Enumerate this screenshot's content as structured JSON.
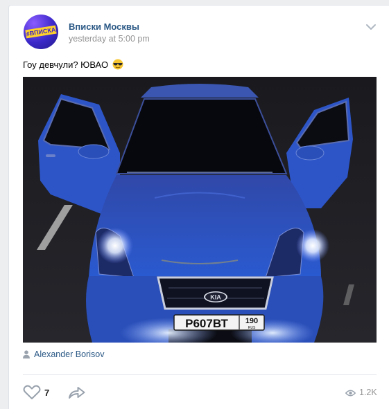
{
  "post": {
    "author": "Вписки Москвы",
    "date": "yesterday at 5:00 pm",
    "avatar_text": "#ВПИСКА",
    "text": "Гоу девчули? ЮВАО",
    "emoji": "sunglasses-face",
    "photo": {
      "plate_number": "Р607ВТ",
      "plate_region": "190",
      "plate_country": "RUS",
      "badge_text": "KIA"
    },
    "signer": "Alexander Borisov",
    "likes": "7",
    "views": "1.2K"
  },
  "icons": {
    "menu": "chevron-down-icon",
    "signer": "user-icon",
    "like": "heart-icon",
    "share": "share-arrow-icon",
    "views": "eye-icon"
  },
  "colors": {
    "link": "#2a5885",
    "meta": "#939393",
    "icon": "#99a2ad",
    "car_body": "#2a4fb8"
  }
}
